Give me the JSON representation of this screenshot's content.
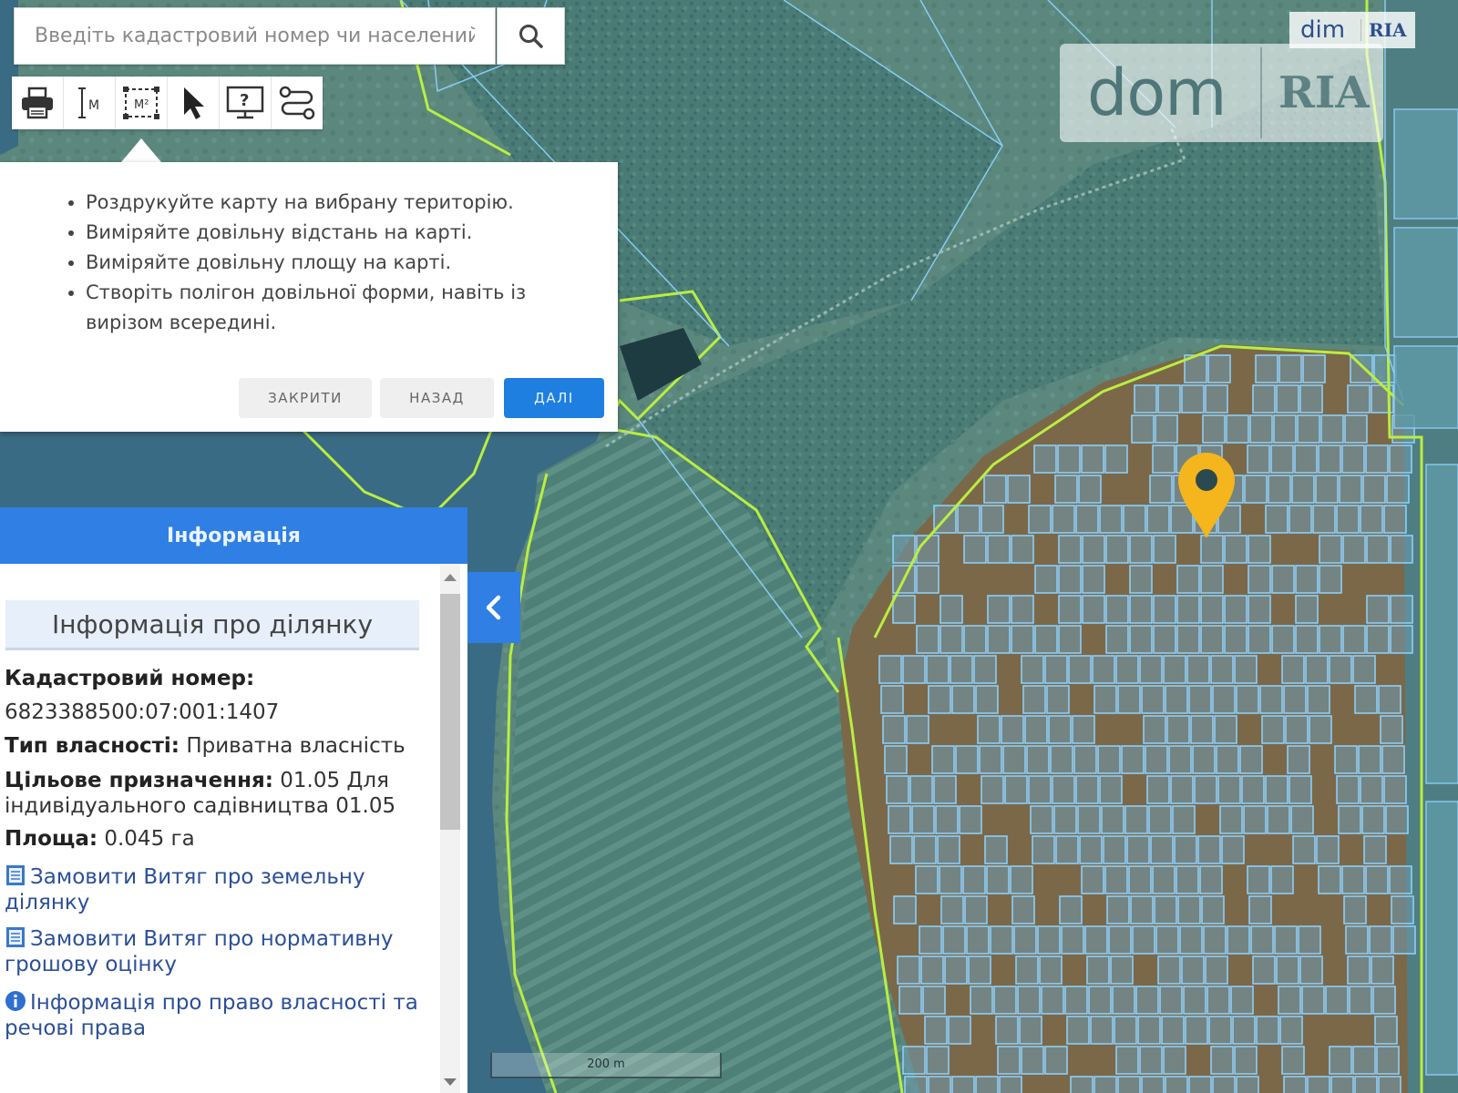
{
  "search": {
    "placeholder": "Введіть кадастровий номер чи населений"
  },
  "toolbar": {
    "tools": [
      {
        "name": "print",
        "icon": "printer-icon"
      },
      {
        "name": "measure-distance",
        "icon": "ruler-m-icon",
        "label": "М"
      },
      {
        "name": "measure-area",
        "icon": "area-m2-icon",
        "label": "М²"
      },
      {
        "name": "select",
        "icon": "cursor-arrow-icon"
      },
      {
        "name": "help",
        "icon": "monitor-question-icon",
        "label": "?"
      },
      {
        "name": "polygon",
        "icon": "polygon-route-icon"
      }
    ]
  },
  "help_popover": {
    "items": [
      "Роздрукуйте карту на вибрану територію.",
      "Виміряйте довільну відстань на карті.",
      "Виміряйте довільну площу на карті.",
      "Створіть полігон довільної форми, навіть із вирізом всередині."
    ],
    "close_label": "ЗАКРИТИ",
    "back_label": "НАЗАД",
    "next_label": "ДАЛІ"
  },
  "info_panel": {
    "header": "Інформація",
    "title": "Інформація про ділянку",
    "cadastral_label": "Кадастровий номер:",
    "cadastral_value": "6823388500:07:001:1407",
    "ownership_label": "Тип власності:",
    "ownership_value": "Приватна власність",
    "purpose_label": "Цільове призначення:",
    "purpose_value": "01.05 Для індивідуального садівництва 01.05",
    "area_label": "Площа:",
    "area_value": "0.045 га",
    "links": [
      "Замовити Витяг про земельну ділянку",
      "Замовити Витяг про нормативну грошову оцінку",
      "Інформація про право власності та речові права"
    ]
  },
  "watermarks": {
    "small_dim": "dim",
    "small_ria": "RIA",
    "large_dom": "dom",
    "large_ria": "RIA"
  },
  "map": {
    "scale_label": "200 m",
    "colors": {
      "forest": "#4d7f7a",
      "water": "#3b6d86",
      "field": "#5f8a7f",
      "parcel_fill": "#7f6a4c",
      "parcel_line": "#8fd3ff",
      "boundary_line": "#b9ee40",
      "marker": "#f5b51c",
      "accent_blue": "#2f7fe4"
    }
  }
}
